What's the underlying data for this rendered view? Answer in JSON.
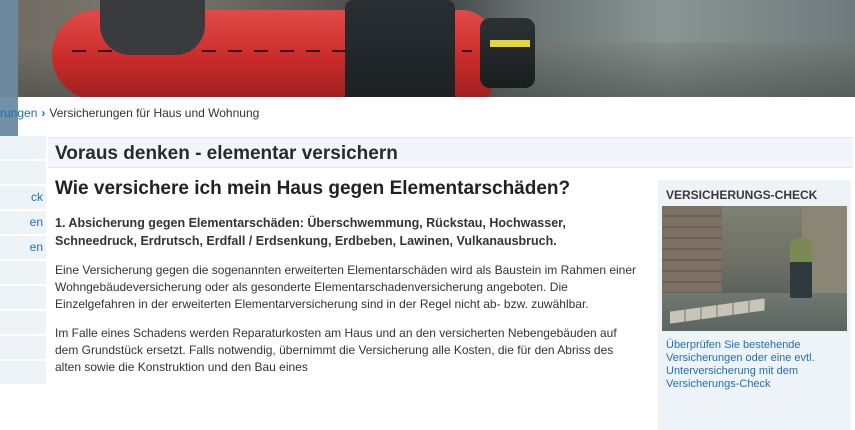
{
  "breadcrumb": {
    "prev": "rungen",
    "separator": "›",
    "current": "Versicherungen für Haus und Wohnung"
  },
  "sidebar": {
    "items": [
      {
        "label": ""
      },
      {
        "label": ""
      },
      {
        "label": "ck"
      },
      {
        "label": "en"
      },
      {
        "label": "en"
      },
      {
        "label": ""
      },
      {
        "label": ""
      },
      {
        "label": ""
      },
      {
        "label": ""
      },
      {
        "label": ""
      }
    ]
  },
  "page": {
    "title": "Voraus denken - elementar versichern"
  },
  "main": {
    "heading": "Wie versichere ich mein Haus gegen Elementarschäden?",
    "lead": "1. Absicherung gegen Elementarschäden: Überschwemmung, Rückstau, Hochwasser, Schneedruck, Erdrutsch, Erdfall / Erdsenkung, Erdbeben, Lawinen, Vulkanausbruch.",
    "para1": "Eine Versicherung gegen die sogenannten erweiterten Elementarschäden wird als Baustein im Rahmen einer Wohngebäudeversicherung oder als gesonderte Elementarschadenversicherung angeboten. Die Einzelgefahren in der erweiterten Elementarversicherung sind in der Regel nicht ab- bzw. zuwählbar.",
    "para2": "Im Falle eines Schadens werden Reparaturkosten am Haus und an den versicherten Nebengebäuden auf dem Grundstück ersetzt. Falls notwendig, übernimmt die Versicherung alle Kosten, die für den Abriss des alten sowie die Konstruktion und den Bau eines"
  },
  "sidebox": {
    "title": "Versicherungs-Check",
    "caption": "Überprüfen Sie bestehende Versicherungen oder eine evtl. Unterversicherung mit dem Versicherungs-Check"
  },
  "colors": {
    "link": "#1f6fb5",
    "title_bar": "#f2f6fa",
    "box_bg": "#eef3f8",
    "accent_overlay": "#6b8aa2"
  }
}
